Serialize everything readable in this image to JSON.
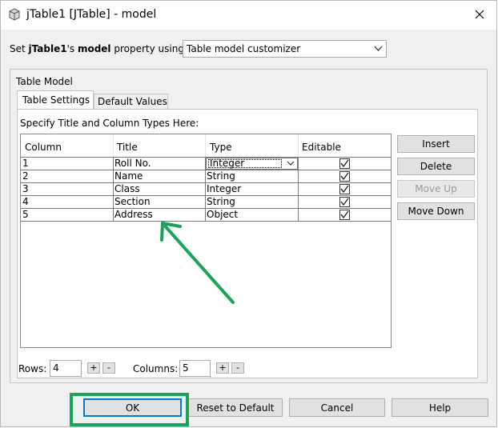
{
  "window": {
    "title": "jTable1 [JTable] - model"
  },
  "property_row": {
    "prefix": "Set ",
    "component": "jTable1",
    "middle": "'s ",
    "property": "model",
    "suffix": " property using:",
    "selector_value": "Table model customizer"
  },
  "group": {
    "label": "Table Model"
  },
  "tabs": [
    {
      "label": "Table Settings",
      "selected": true
    },
    {
      "label": "Default Values",
      "selected": false
    }
  ],
  "instructions": "Specify Title and Column Types Here:",
  "table": {
    "headers": [
      "Column",
      "Title",
      "Type",
      "Editable"
    ],
    "rows": [
      {
        "column": "1",
        "title": "Roll No.",
        "type": "Integer",
        "editable": true
      },
      {
        "column": "2",
        "title": "Name",
        "type": "String",
        "editable": true
      },
      {
        "column": "3",
        "title": "Class",
        "type": "Integer",
        "editable": true
      },
      {
        "column": "4",
        "title": "Section",
        "type": "String",
        "editable": true
      },
      {
        "column": "5",
        "title": "Address",
        "type": "Object",
        "editable": true
      }
    ]
  },
  "side_buttons": {
    "insert": "Insert",
    "delete": "Delete",
    "move_up": "Move Up",
    "move_down": "Move Down"
  },
  "bottom": {
    "rows_label": "Rows:",
    "rows_value": "4",
    "columns_label": "Columns:",
    "columns_value": "5",
    "plus": "+",
    "minus": "-"
  },
  "footer": {
    "ok": "OK",
    "reset": "Reset to Default",
    "cancel": "Cancel",
    "help": "Help"
  },
  "annotations": {
    "highlight_color": "#1aa35a"
  }
}
